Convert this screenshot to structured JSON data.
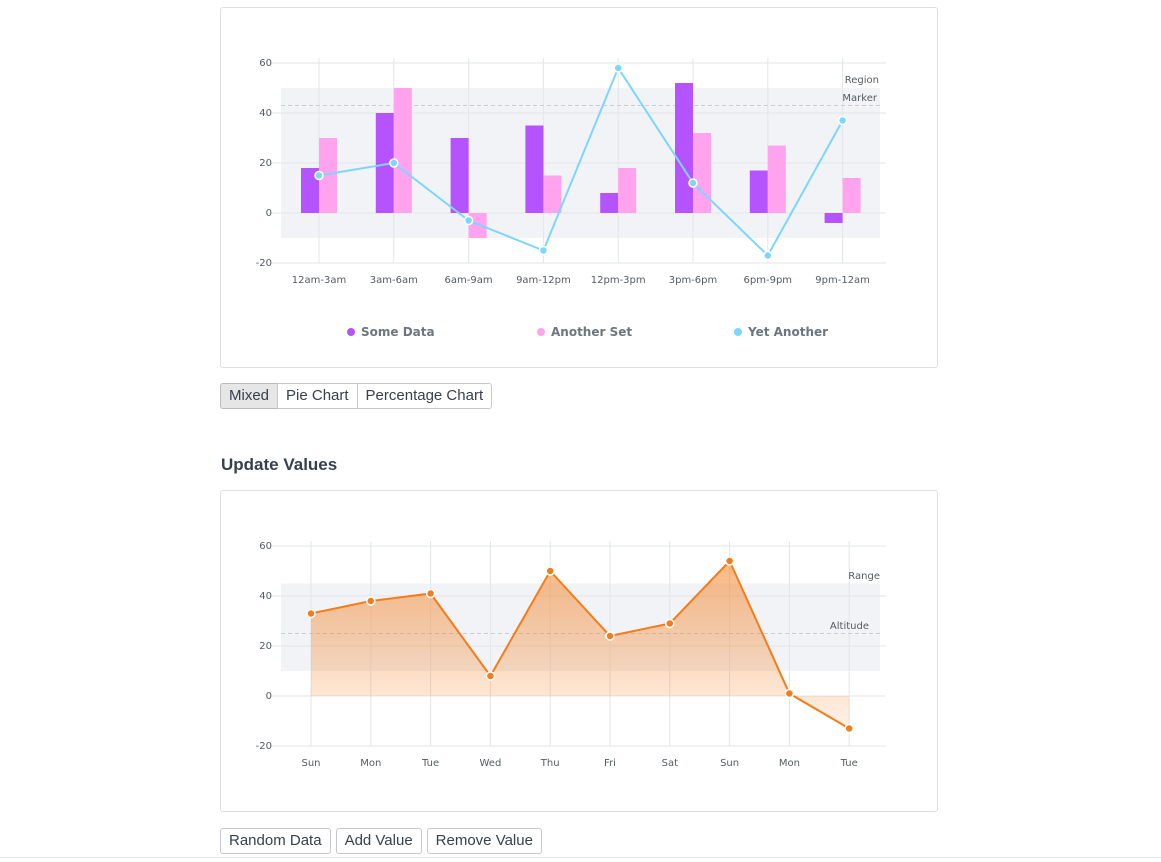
{
  "chart1": {
    "buttons": [
      {
        "label": "Mixed",
        "active": true
      },
      {
        "label": "Pie Chart",
        "active": false
      },
      {
        "label": "Percentage Chart",
        "active": false
      }
    ],
    "colors": {
      "series1": "#b554ff",
      "series2": "#ffa3ef",
      "series3": "#7cd6fd"
    }
  },
  "chart2": {
    "heading": "Update Values",
    "buttons": [
      "Random Data",
      "Add Value",
      "Remove Value"
    ],
    "color": "#f57c1a"
  },
  "chart_data": [
    {
      "type": "bar",
      "categories": [
        "12am-3am",
        "3am-6am",
        "6am-9am",
        "9am-12pm",
        "12pm-3pm",
        "3pm-6pm",
        "6pm-9pm",
        "9pm-12am"
      ],
      "series": [
        {
          "name": "Some Data",
          "kind": "bar",
          "values": [
            18,
            40,
            30,
            35,
            8,
            52,
            17,
            -4
          ]
        },
        {
          "name": "Another Set",
          "kind": "bar",
          "values": [
            30,
            50,
            -10,
            15,
            18,
            32,
            27,
            14
          ]
        },
        {
          "name": "Yet Another",
          "kind": "line",
          "values": [
            15,
            20,
            -3,
            -15,
            58,
            12,
            -17,
            37
          ]
        }
      ],
      "yticks": [
        60,
        40,
        20,
        0,
        -20
      ],
      "ylim": [
        -20,
        60
      ],
      "region": {
        "label": "Region",
        "from": -10,
        "to": 50
      },
      "marker": {
        "label": "Marker",
        "value": 43
      },
      "legend_position": "bottom",
      "grid": true
    },
    {
      "type": "area",
      "categories": [
        "Sun",
        "Mon",
        "Tue",
        "Wed",
        "Thu",
        "Fri",
        "Sat",
        "Sun",
        "Mon",
        "Tue"
      ],
      "series": [
        {
          "values": [
            33,
            38,
            41,
            8,
            50,
            24,
            29,
            54,
            1,
            -13
          ]
        }
      ],
      "yticks": [
        60,
        40,
        20,
        0,
        -20
      ],
      "ylim": [
        -20,
        60
      ],
      "region": {
        "label": "Range",
        "from": 10,
        "to": 45
      },
      "marker": {
        "label": "Altitude",
        "value": 25
      },
      "grid": true
    }
  ]
}
